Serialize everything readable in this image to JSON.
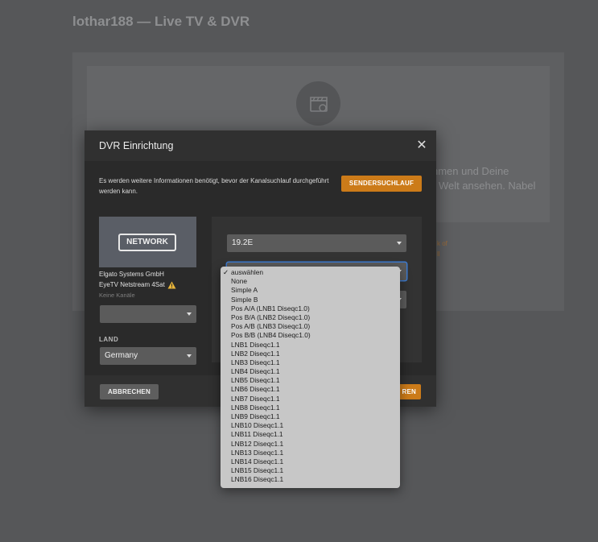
{
  "page": {
    "title": "lothar188 — Live TV & DVR",
    "bg_text_line1": "hmen und Deine",
    "bg_text_line2": "r Welt ansehen. Nabel",
    "bg_orange_line1": "k of",
    "bg_orange_line2": "ll"
  },
  "modal": {
    "title": "DVR Einrichtung",
    "info": "Es werden weitere Informationen benötigt, bevor der Kanalsuchlauf durchgeführt werden kann.",
    "scan_button": "SENDERSUCHLAUF",
    "device": {
      "badge": "NETWORK",
      "vendor": "Elgato Systems GmbH",
      "model": "EyeTV Netstream 4Sat",
      "channels": "Keine Kanäle"
    },
    "land_label": "LAND",
    "land_value": "Germany",
    "satellite_value": "19.2E",
    "cancel_button": "ABBRECHEN",
    "next_button_fragment": "REN"
  },
  "dropdown": {
    "selected": "auswählen",
    "options": [
      "auswählen",
      "None",
      "Simple A",
      "Simple B",
      "Pos A/A (LNB1 Diseqc1.0)",
      "Pos B/A (LNB2 Diseqc1.0)",
      "Pos A/B (LNB3 Diseqc1.0)",
      "Pos B/B (LNB4 Diseqc1.0)",
      "LNB1 Diseqc1.1",
      "LNB2 Diseqc1.1",
      "LNB3 Diseqc1.1",
      "LNB4 Diseqc1.1",
      "LNB5 Diseqc1.1",
      "LNB6 Diseqc1.1",
      "LNB7 Diseqc1.1",
      "LNB8 Diseqc1.1",
      "LNB9 Diseqc1.1",
      "LNB10 Diseqc1.1",
      "LNB11 Diseqc1.1",
      "LNB12 Diseqc1.1",
      "LNB13 Diseqc1.1",
      "LNB14 Diseqc1.1",
      "LNB15 Diseqc1.1",
      "LNB16 Diseqc1.1"
    ]
  },
  "colors": {
    "accent": "#cc7b19",
    "focus": "#3d7bd0",
    "warning": "#e8b53a"
  }
}
